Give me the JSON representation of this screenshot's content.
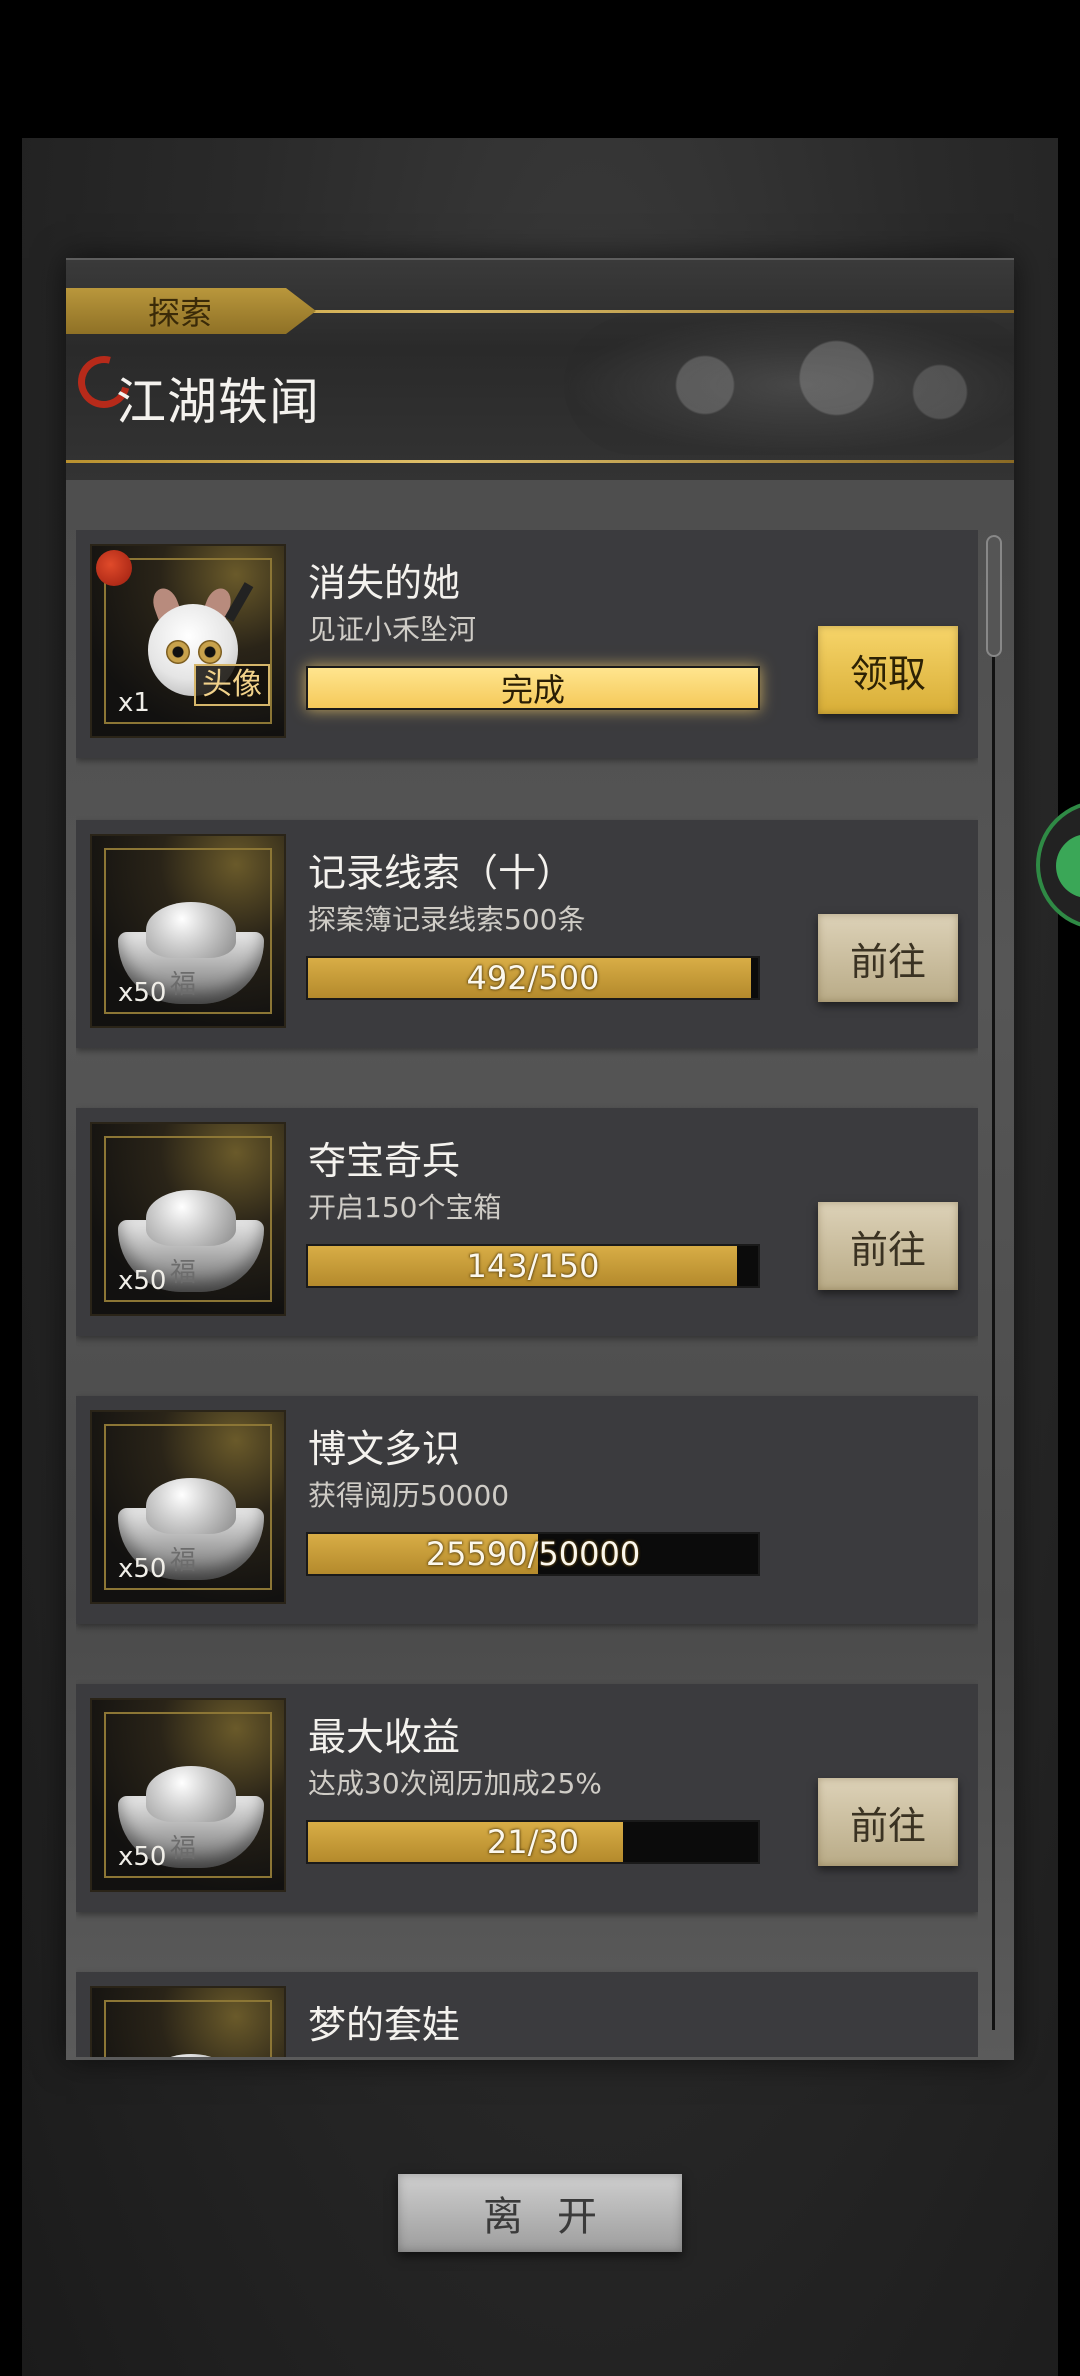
{
  "header": {
    "tag": "探索",
    "title": "江湖轶闻"
  },
  "tasks": [
    {
      "name": "消失的她",
      "desc": "见证小禾坠河",
      "reward_count": "x1",
      "reward_label": "头像",
      "progress_text": "完成",
      "progress": 1.0,
      "button": "领取"
    },
    {
      "name": "记录线索（十）",
      "desc": "探案簿记录线索500条",
      "reward_count": "x50",
      "progress_text": "492/500",
      "progress": 0.984,
      "button": "前往"
    },
    {
      "name": "夺宝奇兵",
      "desc": "开启150个宝箱",
      "reward_count": "x50",
      "progress_text": "143/150",
      "progress": 0.953,
      "button": "前往"
    },
    {
      "name": "博文多识",
      "desc": "获得阅历50000",
      "reward_count": "x50",
      "progress_text": "25590/50000",
      "progress": 0.512
    },
    {
      "name": "最大收益",
      "desc": "达成30次阅历加成25%",
      "reward_count": "x50",
      "progress_text": "21/30",
      "progress": 0.7,
      "button": "前往"
    },
    {
      "name": "梦的套娃"
    }
  ],
  "footer": {
    "leave_label": "离开"
  },
  "colors": {
    "gold": "#d8ad46",
    "done_bar": "#ffe58e",
    "red_dot": "#c8321c"
  }
}
